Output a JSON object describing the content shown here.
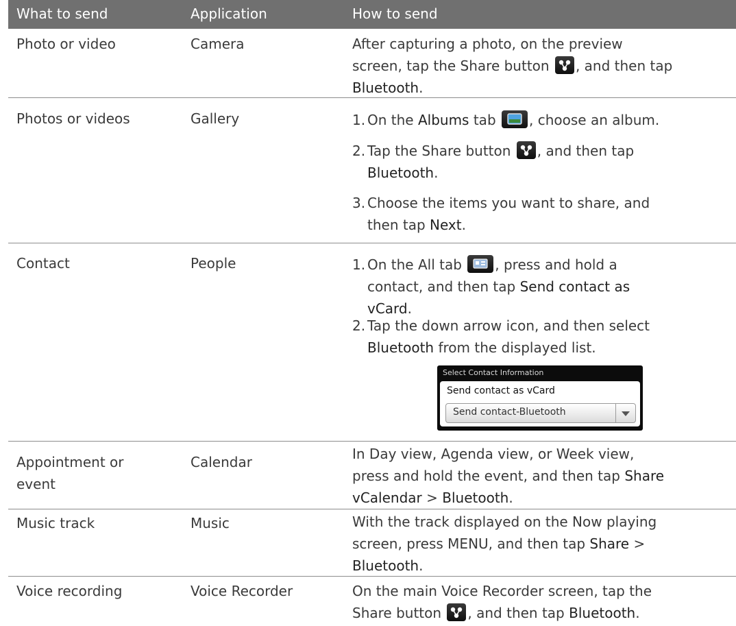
{
  "header": {
    "col1": "What to send",
    "col2": "Application",
    "col3": "How to send"
  },
  "rows": [
    {
      "what": "Photo or video",
      "app": "Camera",
      "how": {
        "l1": "After capturing a photo, on the preview",
        "l2a": "screen, tap the Share button",
        "l2b": ", and then tap",
        "l3": "Bluetooth",
        "l3b": "."
      }
    },
    {
      "what": "Photos or videos",
      "app": "Gallery",
      "steps": [
        {
          "num": "1.",
          "a": "On the",
          "b": "Albums",
          "c": "tab",
          "d": ", choose an album."
        },
        {
          "num": "2.",
          "a": "Tap the Share button",
          "b": ", and then tap",
          "c": "Bluetooth",
          "d": "."
        },
        {
          "num": "3.",
          "a": "Choose the items you want to share, and",
          "b": "then tap",
          "c": "Next",
          "d": "."
        }
      ]
    },
    {
      "what": "Contact",
      "app": "People",
      "steps": [
        {
          "num": "1.",
          "a": "On the All tab",
          "b": ", press and hold a",
          "c": "contact, and then tap",
          "d": "Send contact as",
          "e": "vCard",
          "f": "."
        },
        {
          "num": "2.",
          "a": "Tap the down arrow icon, and then select",
          "b": "Bluetooth",
          "c": "from the displayed list."
        }
      ],
      "dialog": {
        "title": "Select Contact Information",
        "label": "Send contact as vCard",
        "selected": "Send contact-Bluetooth"
      }
    },
    {
      "what_l1": "Appointment or",
      "what_l2": "event",
      "app": "Calendar",
      "how": {
        "l1": "In Day view, Agenda view, or Week view,",
        "l2a": "press and hold the event, and then tap",
        "l2b": "Share",
        "l3a": "vCalendar",
        "l3b": " > ",
        "l3c": "Bluetooth",
        "l3d": "."
      }
    },
    {
      "what": "Music track",
      "app": "Music",
      "how": {
        "l1": "With the track displayed on the Now playing",
        "l2a": "screen, press MENU, and then tap",
        "l2b": "Share",
        "l2c": " >",
        "l3": "Bluetooth",
        "l3b": "."
      }
    },
    {
      "what": "Voice recording",
      "app": "Voice Recorder",
      "how": {
        "l1": "On the main Voice Recorder screen, tap the",
        "l2a": "Share button",
        "l2b": ", and then tap",
        "l2c": "Bluetooth",
        "l2d": "."
      }
    }
  ],
  "icons": {
    "share": "share-icon",
    "albums": "albums-tab-icon",
    "all": "all-tab-icon"
  }
}
